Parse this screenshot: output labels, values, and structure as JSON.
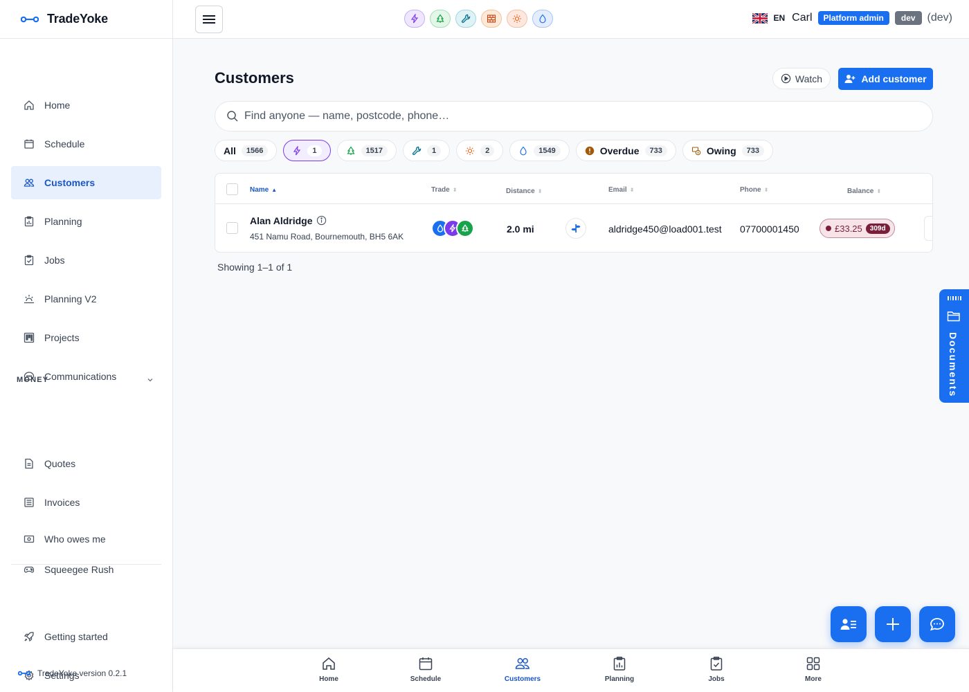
{
  "app": {
    "name": "TradeYoke",
    "version_label": "TradeYoke version 0.2.1"
  },
  "sidebar": {
    "items": [
      {
        "label": "Home",
        "icon": "home-icon"
      },
      {
        "label": "Schedule",
        "icon": "calendar-icon"
      },
      {
        "label": "Customers",
        "icon": "users-icon",
        "active": true
      },
      {
        "label": "Planning",
        "icon": "planning-icon"
      },
      {
        "label": "Jobs",
        "icon": "clipboard-icon"
      },
      {
        "label": "Planning V2",
        "icon": "sunrise-icon"
      },
      {
        "label": "Projects",
        "icon": "kanban-icon"
      },
      {
        "label": "Communications",
        "icon": "chat-icon"
      }
    ],
    "money_section": {
      "label": "MONEY"
    },
    "money_items": [
      {
        "label": "Quotes",
        "icon": "document-icon"
      },
      {
        "label": "Invoices",
        "icon": "invoice-icon"
      },
      {
        "label": "Who owes me",
        "icon": "money-icon"
      },
      {
        "label": "Squeegee Rush",
        "icon": "gamepad-icon"
      }
    ],
    "bottom_items": [
      {
        "label": "Getting started",
        "icon": "rocket-icon"
      },
      {
        "label": "Settings",
        "icon": "gear-icon"
      }
    ]
  },
  "topbar": {
    "lang": "EN",
    "user": "Carl",
    "role_badge": "Platform admin",
    "env_badge": "dev",
    "env_text": "(dev)",
    "trade_pills": [
      {
        "icon": "lightning-icon",
        "color": "#7c3aed",
        "bg": "#efe7fd"
      },
      {
        "icon": "tree-icon",
        "color": "#16a34a",
        "bg": "#e3f6e8"
      },
      {
        "icon": "wrench-icon",
        "color": "#0e7490",
        "bg": "#dff3f7"
      },
      {
        "icon": "brick-icon",
        "color": "#c2410c",
        "bg": "#fde9d7"
      },
      {
        "icon": "sun-icon",
        "color": "#ea580c",
        "bg": "#fde8df"
      },
      {
        "icon": "droplet-icon",
        "color": "#1a6ff0",
        "bg": "#e3edfd"
      }
    ]
  },
  "main": {
    "title": "Customers",
    "watch_label": "Watch",
    "add_label": "Add customer",
    "search_placeholder": "Find anyone — name, postcode, phone…",
    "filters": [
      {
        "label": "All",
        "count": "1566"
      },
      {
        "icon": "lightning-icon",
        "count": "1",
        "active": true
      },
      {
        "icon": "tree-icon",
        "count": "1517"
      },
      {
        "icon": "wrench-icon",
        "count": "1"
      },
      {
        "icon": "sun-icon",
        "count": "2"
      },
      {
        "icon": "droplet-icon",
        "count": "1549"
      },
      {
        "icon": "alert-icon",
        "label": "Overdue",
        "count": "733"
      },
      {
        "icon": "owing-icon",
        "label": "Owing",
        "count": "733"
      }
    ],
    "table": {
      "columns": [
        "Name",
        "Trade",
        "Distance",
        "Email",
        "Phone",
        "Balance"
      ],
      "rows": [
        {
          "name": "Alan Aldridge",
          "address": "451 Namu Road, Bournemouth, BH5 6AK",
          "distance": "2.0 mi",
          "email": "aldridge450@load001.test",
          "phone": "07700001450",
          "balance": "£33.25",
          "balance_age": "309d"
        }
      ]
    },
    "showing": "Showing 1–1 of 1"
  },
  "documents_tab": {
    "label": "Documents"
  },
  "bottom_nav": [
    {
      "label": "Home",
      "icon": "home-icon"
    },
    {
      "label": "Schedule",
      "icon": "calendar-icon"
    },
    {
      "label": "Customers",
      "icon": "users-icon",
      "active": true
    },
    {
      "label": "Planning",
      "icon": "planning-icon"
    },
    {
      "label": "Jobs",
      "icon": "clipboard-icon"
    },
    {
      "label": "More",
      "icon": "grid-icon"
    }
  ],
  "colors": {
    "accent": "#1a6ff0",
    "active_bg": "#e8f0fd",
    "balance_overdue": "#7a1f3a"
  }
}
